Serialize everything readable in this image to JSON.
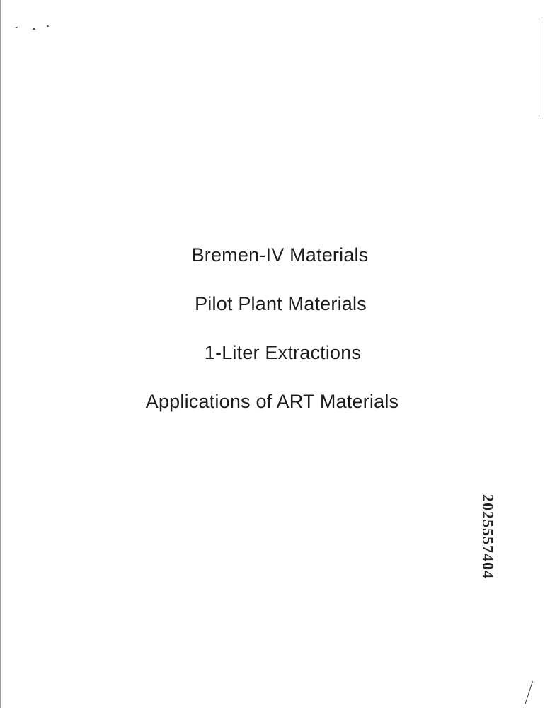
{
  "document": {
    "items": [
      "Bremen-IV Materials",
      "Pilot Plant Materials",
      "1-Liter Extractions",
      "Applications of ART Materials"
    ],
    "bates_number": "2025557404"
  }
}
